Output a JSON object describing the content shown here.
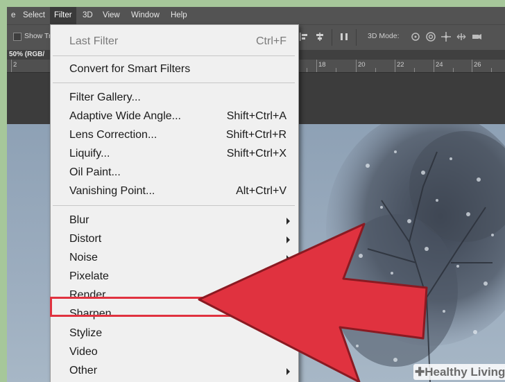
{
  "menubar": {
    "items": [
      {
        "label": "e"
      },
      {
        "label": "Select"
      },
      {
        "label": "Filter"
      },
      {
        "label": "3D"
      },
      {
        "label": "View"
      },
      {
        "label": "Window"
      },
      {
        "label": "Help"
      }
    ],
    "active": "Filter"
  },
  "options_bar": {
    "show_label": "Show Tr",
    "mode_label": "3D Mode:"
  },
  "document": {
    "tab_label": "50% (RGB/"
  },
  "ruler": {
    "labels": [
      "2",
      "18",
      "20",
      "22",
      "24",
      "26"
    ]
  },
  "filter_menu": {
    "last_filter": {
      "label": "Last Filter",
      "shortcut": "Ctrl+F"
    },
    "convert": {
      "label": "Convert for Smart Filters"
    },
    "items": [
      {
        "label": "Filter Gallery...",
        "shortcut": ""
      },
      {
        "label": "Adaptive Wide Angle...",
        "shortcut": "Shift+Ctrl+A"
      },
      {
        "label": "Lens Correction...",
        "shortcut": "Shift+Ctrl+R"
      },
      {
        "label": "Liquify...",
        "shortcut": "Shift+Ctrl+X"
      },
      {
        "label": "Oil Paint...",
        "shortcut": ""
      },
      {
        "label": "Vanishing Point...",
        "shortcut": "Alt+Ctrl+V"
      }
    ],
    "submenus": [
      {
        "label": "Blur",
        "has_submenu": true
      },
      {
        "label": "Distort",
        "has_submenu": true
      },
      {
        "label": "Noise",
        "has_submenu": true
      },
      {
        "label": "Pixelate",
        "has_submenu": false
      },
      {
        "label": "Render",
        "has_submenu": false
      },
      {
        "label": "Sharpen",
        "has_submenu": false,
        "highlighted": true
      },
      {
        "label": "Stylize",
        "has_submenu": false
      },
      {
        "label": "Video",
        "has_submenu": false
      },
      {
        "label": "Other",
        "has_submenu": true
      }
    ]
  },
  "annotation": {
    "highlight_color": "#e0323f",
    "arrow_color": "#e0323f"
  },
  "watermark": {
    "text": "Healthy Living"
  }
}
